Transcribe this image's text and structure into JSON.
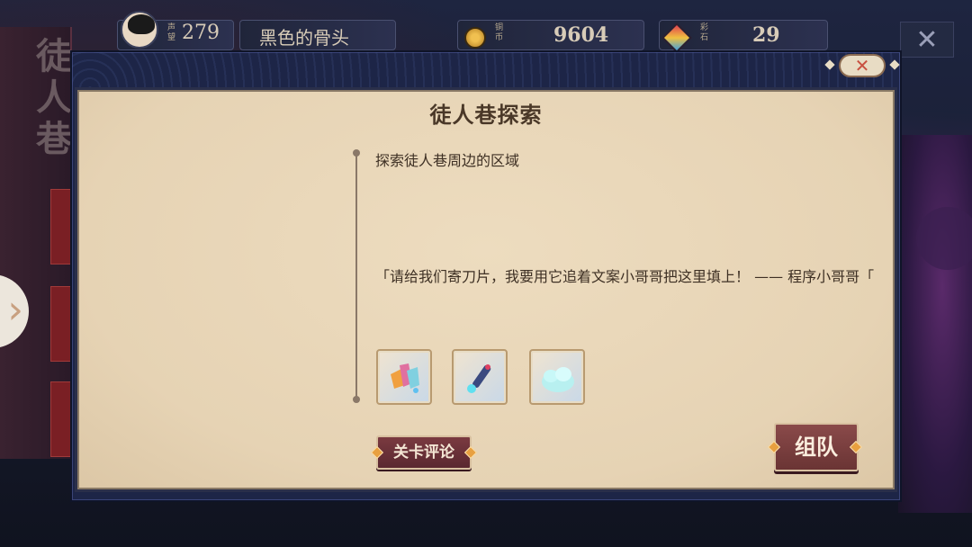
{
  "hud": {
    "rank_label": "声望",
    "rank_value": "279",
    "player_name": "黑色的骨头",
    "coin_label": "铜币",
    "coin_value": "9604",
    "gem_label": "彩石",
    "gem_value": "29",
    "close_icon": "close-icon"
  },
  "background": {
    "left_title": "徒人巷"
  },
  "modal": {
    "title": "徒人巷探索",
    "description": "探索徒人巷周边的区域",
    "quote": "「请给我们寄刀片，我要用它追着文案小哥哥把这里填上！ —— 程序小哥哥「",
    "rewards": [
      {
        "icon": "crystal-shards-icon"
      },
      {
        "icon": "blue-pen-icon"
      },
      {
        "icon": "cloud-stone-icon"
      }
    ],
    "comment_button": "关卡评论",
    "team_button": "组队",
    "close_icon": "close-icon"
  },
  "colors": {
    "paper": "#e6d3b4",
    "frame": "#1d2547",
    "button": "#6a3434",
    "title_text": "#4a3828"
  }
}
